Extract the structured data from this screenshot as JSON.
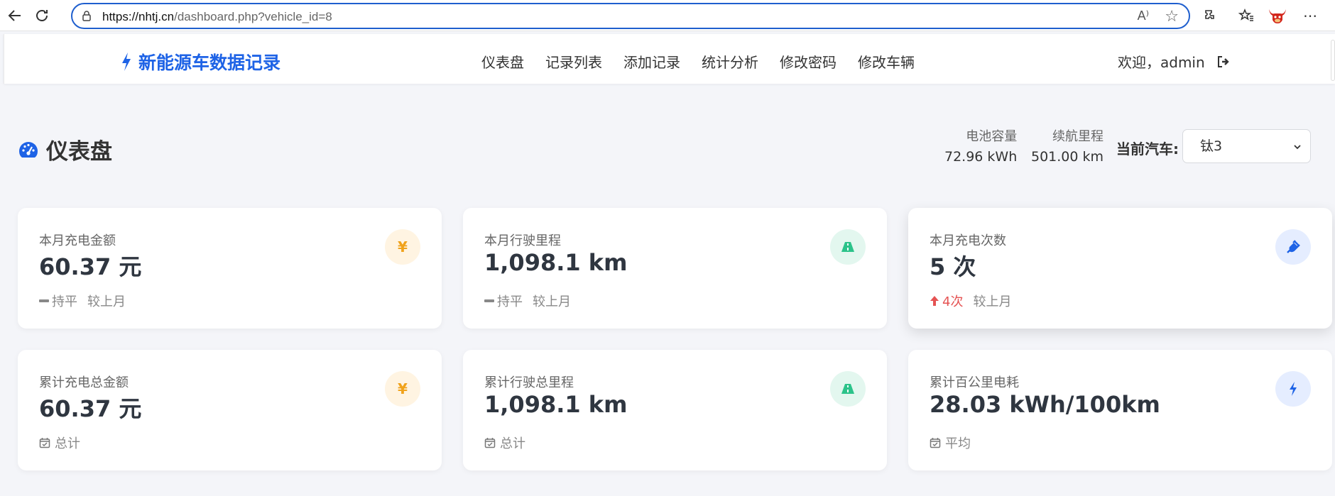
{
  "browser": {
    "url_host": "https://nhtj.cn",
    "url_rest": "/dashboard.php?vehicle_id=8",
    "read_aloud_glyph": "A⁾"
  },
  "app": {
    "brand": "新能源车数据记录",
    "nav": [
      "仪表盘",
      "记录列表",
      "添加记录",
      "统计分析",
      "修改密码",
      "修改车辆"
    ],
    "welcome": "欢迎，admin"
  },
  "page": {
    "title": "仪表盘",
    "battery_label": "电池容量",
    "battery_value": "72.96 kWh",
    "range_label": "续航里程",
    "range_value": "501.00 km",
    "vehicle_label": "当前汽车:",
    "vehicle_selected": "钛3"
  },
  "cards": [
    {
      "label": "本月充电金额",
      "value": "60.37 元",
      "trend": "持平",
      "compare": "较上月",
      "icon": "yen-icon"
    },
    {
      "label": "本月行驶里程",
      "value": "1,098.1 km",
      "trend": "持平",
      "compare": "较上月",
      "icon": "road-icon"
    },
    {
      "label": "本月充电次数",
      "value": "5 次",
      "trend": "4次",
      "compare": "较上月",
      "icon": "plug-icon"
    },
    {
      "label": "累计充电总金额",
      "value": "60.37 元",
      "foot": "总计",
      "icon": "yen-icon"
    },
    {
      "label": "累计行驶总里程",
      "value": "1,098.1 km",
      "foot": "总计",
      "icon": "road-icon"
    },
    {
      "label": "累计百公里电耗",
      "value": "28.03 kWh/100km",
      "foot": "平均",
      "icon": "bolt-icon"
    }
  ],
  "colors": {
    "brand": "#1e63e6",
    "yen": "#f0a21b",
    "road": "#2cc38a",
    "trend_up": "#e55353"
  }
}
